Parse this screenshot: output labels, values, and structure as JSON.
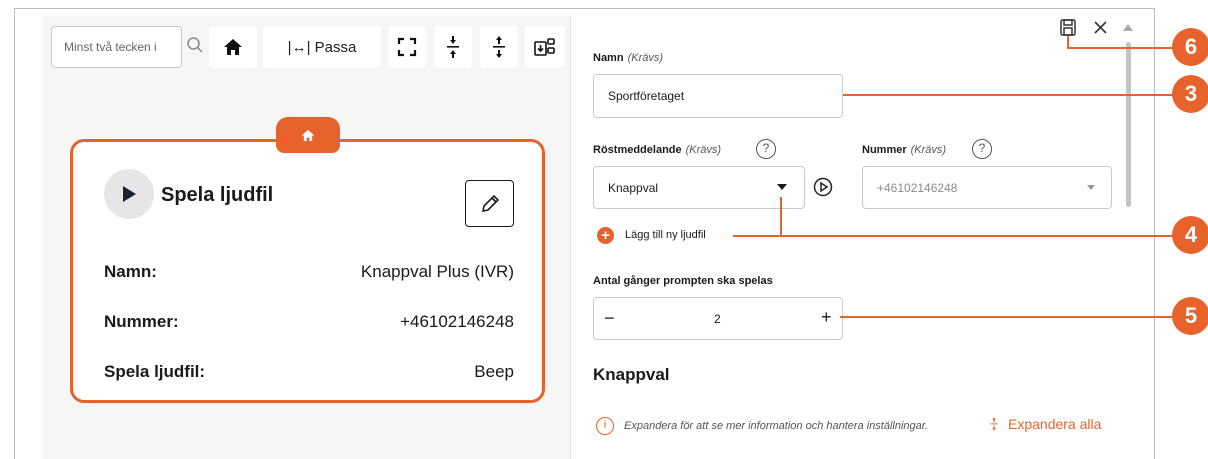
{
  "toolbar": {
    "search_placeholder": "Minst två tecken i",
    "fit_label": "|↔| Passa"
  },
  "card": {
    "title": "Spela ljudfil",
    "rows": [
      {
        "label": "Namn:",
        "value": "Knappval Plus (IVR)"
      },
      {
        "label": "Nummer:",
        "value": "+46102146248"
      },
      {
        "label": "Spela ljudfil:",
        "value": "Beep"
      }
    ]
  },
  "form": {
    "name_label": "Namn",
    "required": "(Krävs)",
    "name_value": "Sportföretaget",
    "voice_label": "Röstmeddelande",
    "voice_value": "Knappval",
    "number_label": "Nummer",
    "number_value": "+46102146248",
    "add_audio": "Lägg till ny ljudfil",
    "repeat_label": "Antal gånger prompten ska spelas",
    "repeat_value": "2",
    "minus": "−",
    "plus": "+",
    "section_title": "Knappval",
    "info_text": "Expandera för att se mer information och hantera inställningar.",
    "expand_all": "Expandera alla",
    "help": "?"
  },
  "callouts": [
    "6",
    "3",
    "4",
    "5"
  ],
  "colors": {
    "accent": "#e8622c"
  }
}
